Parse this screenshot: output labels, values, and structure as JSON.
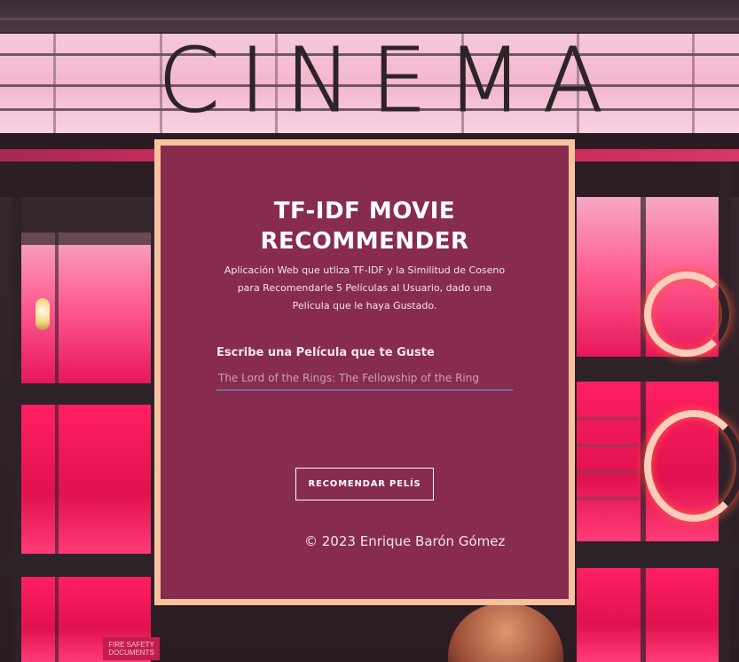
{
  "background": {
    "marquee_text": "CINEMA",
    "sign_text": "FIRE SAFETY DOCUMENTS"
  },
  "card": {
    "title_line1": "TF-IDF MOVIE",
    "title_line2": "RECOMMENDER",
    "description": "Aplicación Web que utliza TF-IDF y la Similitud de Coseno para Recomendarle 5 Películas al Usuario, dado una Película que le haya Gustado.",
    "input_label": "Escribe una Película que te Guste",
    "input_placeholder": "The Lord of the Rings: The Fellowship of the Ring",
    "input_value": "",
    "submit_label": "RECOMENDAR PELÍS",
    "copyright": "© 2023 Enrique Barón Gómez"
  },
  "colors": {
    "card_background": "#872c4e",
    "card_border": "#f7c39e",
    "input_underline": "#5aa7d6",
    "neon_pink": "#ff1f63"
  }
}
